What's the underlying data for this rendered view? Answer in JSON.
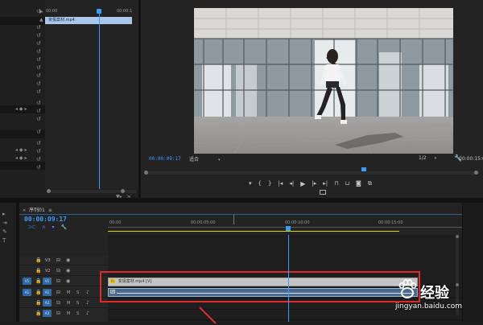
{
  "effect_controls": {
    "time_start": "00:00",
    "time_end": "00:00:1",
    "clip_label": "变极案材.mp4"
  },
  "program_monitor": {
    "timecode": "00:00:09:17",
    "fit": "适合",
    "resolution": "1/2",
    "duration": "00:00:15:00"
  },
  "sequence": {
    "tab_label": "序列01",
    "timecode": "00:00:09:17",
    "ruler": [
      "00:00",
      "00:00:05:00",
      "00:00:10:00",
      "00:00:15:00"
    ],
    "tracks_video": [
      "V3",
      "V2",
      "V1"
    ],
    "tracks_audio": [
      "A1",
      "A2",
      "A3"
    ],
    "track_source_video": "V1",
    "track_source_audio": "A1",
    "video_clip_label": "变极案材.mp4 [V]"
  },
  "watermark": {
    "text": "经验",
    "url": "jingyan.baidu.com"
  },
  "colors": {
    "accent": "#3b9cff",
    "highlight": "#e0292b",
    "work_area": "#d8d800"
  }
}
